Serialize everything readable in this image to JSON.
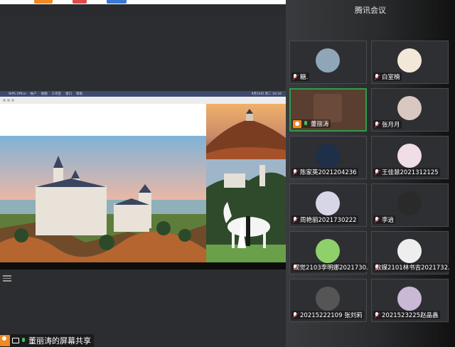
{
  "app": {
    "title": "腾讯会议"
  },
  "share_window": {
    "menubar": {
      "apple": "",
      "app_name": "WPS Office",
      "items": [
        "帐户",
        "视图",
        "工作区",
        "窗口",
        "帮助"
      ],
      "right_text": "9月14日 周二 16:34"
    },
    "images": [
      {
        "name": "castle-main",
        "alt": "Neuschwanstein castle at sunset"
      },
      {
        "name": "castle-on-hill",
        "alt": "Castle on hill at sunset"
      },
      {
        "name": "wedding-photo",
        "alt": "Couple with white horse in front of castle"
      }
    ]
  },
  "share_label": {
    "text": "董丽涛的屏幕共享"
  },
  "participants": [
    {
      "name": "糖.",
      "muted": true,
      "host": false,
      "active": false,
      "avatar_color": "#8fa6b8"
    },
    {
      "name": "白室楠",
      "muted": true,
      "host": false,
      "active": false,
      "avatar_color": "#f3e8d8"
    },
    {
      "name": "董丽涛",
      "muted": false,
      "host": true,
      "active": true,
      "avatar_color": "#6b4a3a"
    },
    {
      "name": "张月月",
      "muted": true,
      "host": false,
      "active": false,
      "avatar_color": "#d9c8c0"
    },
    {
      "name": "陈家英2021204236",
      "muted": true,
      "host": false,
      "active": false,
      "avatar_color": "#1e2f4a"
    },
    {
      "name": "王佳慧2021312125",
      "muted": true,
      "host": false,
      "active": false,
      "avatar_color": "#f1dde6"
    },
    {
      "name": "周艳丽2021730222",
      "muted": true,
      "host": false,
      "active": false,
      "avatar_color": "#d6d6e6"
    },
    {
      "name": "李逍",
      "muted": true,
      "host": false,
      "active": false,
      "avatar_color": "#2a2a2a"
    },
    {
      "name": "视觉2103李明娜2021730...",
      "muted": true,
      "host": false,
      "active": false,
      "avatar_color": "#8fd06a"
    },
    {
      "name": "数媒2101林书吉2021732...",
      "muted": true,
      "host": false,
      "active": false,
      "avatar_color": "#eeeeee"
    },
    {
      "name": "20215222109 张刘莉",
      "muted": true,
      "host": false,
      "active": false,
      "avatar_color": "#555555"
    },
    {
      "name": "2021523225赵晶鑫",
      "muted": true,
      "host": false,
      "active": false,
      "avatar_color": "#c9b8d6"
    }
  ]
}
